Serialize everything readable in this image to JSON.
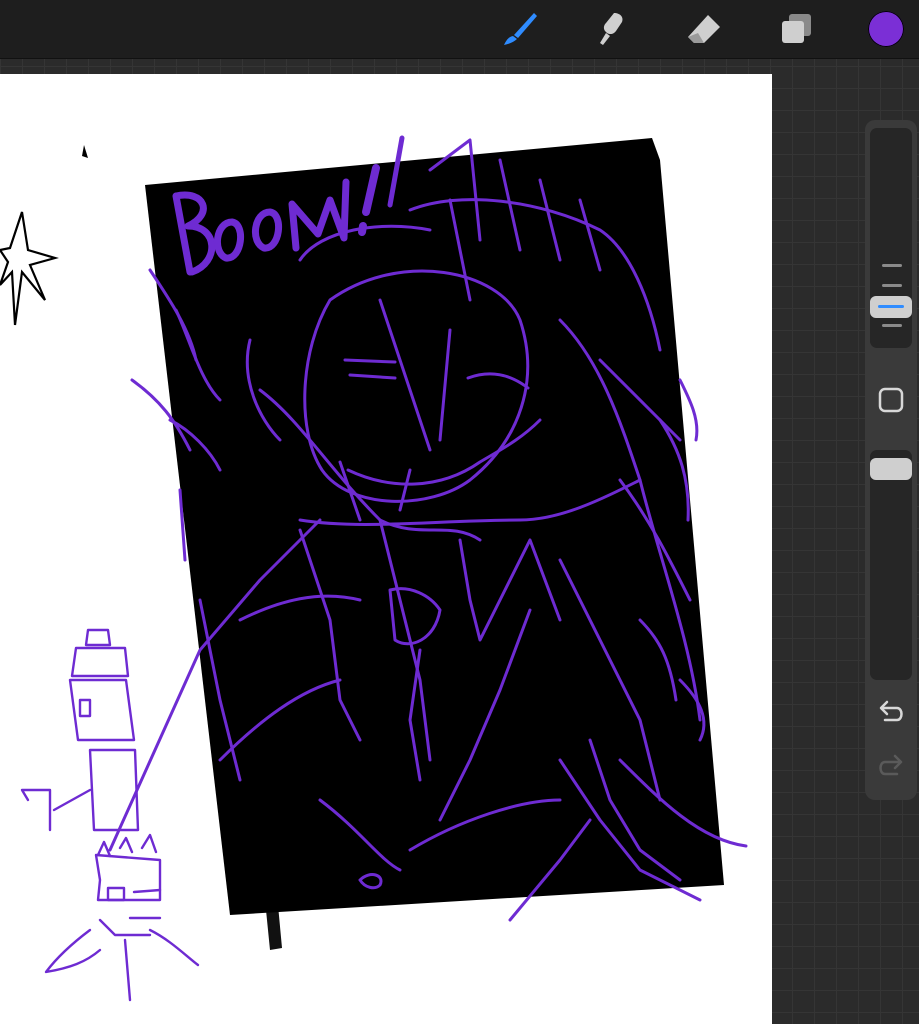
{
  "app": {
    "toolbar": {
      "tools": [
        {
          "name": "brush",
          "icon": "brush-icon",
          "active": true
        },
        {
          "name": "smudge",
          "icon": "smudge-icon",
          "active": false
        },
        {
          "name": "eraser",
          "icon": "eraser-icon",
          "active": false
        },
        {
          "name": "layers",
          "icon": "layers-icon",
          "active": false
        }
      ],
      "current_color": "#7b2fd6"
    },
    "sidebar": {
      "modify_icon": "square-modify-icon",
      "undo_icon": "undo-icon",
      "redo_icon": "redo-icon"
    }
  },
  "canvas": {
    "drawing_text": "Boom!",
    "colors": {
      "ink": "#6e2bd2",
      "fill": "#000000",
      "paper": "#ffffff"
    }
  }
}
